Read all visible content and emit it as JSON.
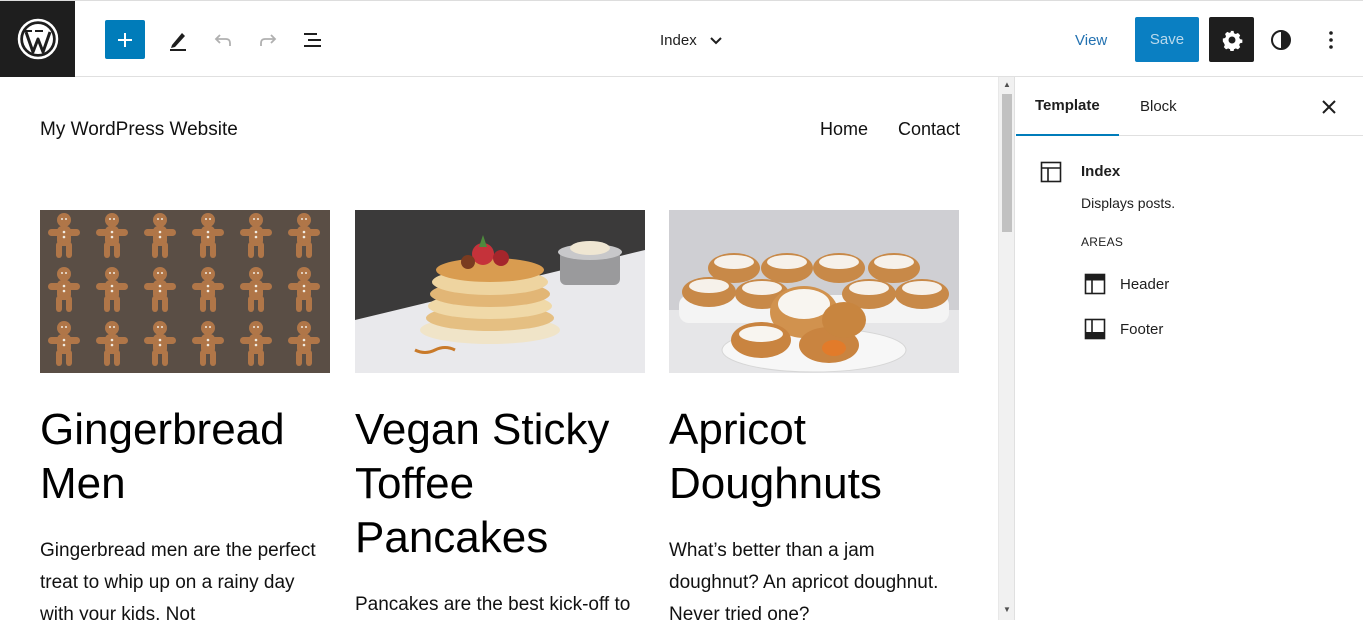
{
  "toolbar": {
    "logo_icon": "wordpress-logo-icon",
    "add_icon": "plus-icon",
    "tools_icon": "pencil-icon",
    "undo_icon": "undo-icon",
    "redo_icon": "redo-icon",
    "list_view_icon": "list-view-icon",
    "document_title": "Index",
    "view_label": "View",
    "save_label": "Save",
    "settings_icon": "gear-icon",
    "styles_icon": "half-circle-icon",
    "options_icon": "vertical-dots-icon",
    "accent_color": "#007cba"
  },
  "canvas": {
    "site_title": "My WordPress Website",
    "nav": [
      "Home",
      "Contact"
    ],
    "posts": [
      {
        "title": "Gingerbread Men",
        "excerpt": "Gingerbread men are the perfect treat to whip up on a rainy day with your kids. Not",
        "image": "gingerbread-cookies-photo"
      },
      {
        "title": "Vegan Sticky Toffee Pancakes",
        "excerpt": "Pancakes are the best kick-off to",
        "image": "pancake-stack-photo"
      },
      {
        "title": "Apricot Doughnuts",
        "excerpt": "What’s better than a jam doughnut? An apricot doughnut. Never tried one?",
        "image": "doughnuts-photo"
      }
    ]
  },
  "sidebar": {
    "tabs": [
      "Template",
      "Block"
    ],
    "active_tab": "Template",
    "template_name": "Index",
    "template_description": "Displays posts.",
    "areas_label": "AREAS",
    "areas": [
      {
        "label": "Header",
        "icon": "header-area-icon"
      },
      {
        "label": "Footer",
        "icon": "footer-area-icon"
      }
    ]
  }
}
